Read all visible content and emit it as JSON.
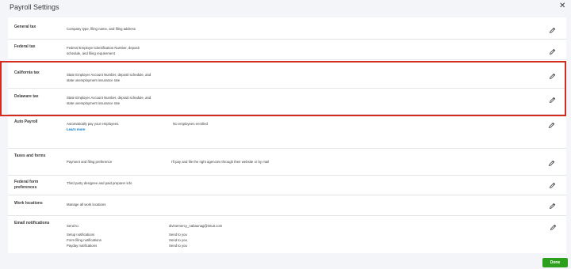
{
  "header": {
    "title": "Payroll Settings",
    "close_glyph": "✕"
  },
  "rows": {
    "general_tax": {
      "label": "General tax",
      "desc": "Company type, filing name, and filing address"
    },
    "federal_tax": {
      "label": "Federal tax",
      "desc_line1": "Federal Employer Identification Number, deposit",
      "desc_line2": "schedule, and filing requirement"
    },
    "california_tax": {
      "label": "California tax",
      "desc_line1": "State Employer Account Number, deposit schedule, and",
      "desc_line2": "state unemployment insurance rate"
    },
    "delaware_tax": {
      "label": "Delaware tax",
      "desc_line1": "State Employer Account Number, deposit schedule, and",
      "desc_line2": "state unemployment insurance rate"
    },
    "auto_payroll": {
      "label": "Auto Payroll",
      "desc": "Automatically pay your employees.",
      "link": "Learn more",
      "value": "No employees enrolled"
    },
    "taxes_forms": {
      "label": "Taxes and forms",
      "desc": "Payment and filing preference",
      "value": "I'll pay and file the right agencies through their website or by mail"
    },
    "federal_form": {
      "label_line1": "Federal form",
      "label_line2": "preferences",
      "desc": "Third party designee and paid preparer info"
    },
    "work_locations": {
      "label": "Work locations",
      "desc": "Manage all work locations"
    },
    "email_notifications": {
      "label": "Email notifications",
      "items": [
        {
          "label": "Send to",
          "value": "divinemercy_nabaunag@intuit.com"
        },
        {
          "label": "Setup notifications",
          "value": "Send to you"
        },
        {
          "label": "Form filing notifications",
          "value": "Send to you"
        },
        {
          "label": "Payday notifications",
          "value": "Send to you"
        }
      ]
    }
  },
  "footer": {
    "done_label": "Done"
  },
  "colors": {
    "highlight": "#d52b1e",
    "primary_button": "#2ca01c",
    "link": "#0077c5"
  },
  "icons": {
    "edit": "pencil-icon",
    "close": "close-icon"
  }
}
